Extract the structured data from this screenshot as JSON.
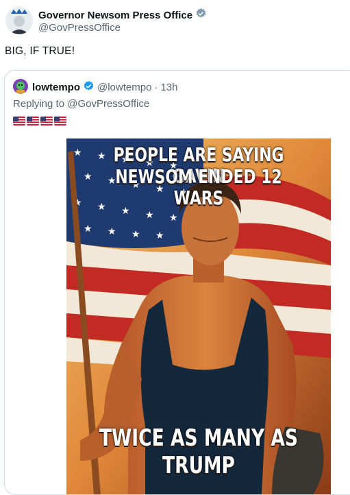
{
  "author": {
    "display_name": "Governor Newsom Press Office",
    "handle": "@GovPressOffice",
    "verified_badge": "gray-verified-badge-icon"
  },
  "tweet": {
    "text": "BIG, IF TRUE!"
  },
  "quoted_tweet": {
    "display_name": "lowtempo",
    "handle": "@lowtempo",
    "separator": "·",
    "time": "13h",
    "verified_badge": "blue-verified-badge-icon",
    "replying_prefix": "Replying to ",
    "replying_to": "@GovPressOffice",
    "flags": [
      "us-flag-icon",
      "us-flag-icon",
      "us-flag-icon",
      "us-flag-icon"
    ],
    "image": {
      "top_text_line1": "PEOPLE ARE SAYING GAVIN",
      "top_text_line2": "NEWSOM ENDED 12 WARS",
      "bottom_text_line1": "TWICE AS MANY AS",
      "bottom_text_line2": "TRUMP"
    }
  },
  "colors": {
    "text_primary": "#0f1419",
    "text_secondary": "#536471",
    "border": "#cfd9de",
    "verified_blue": "#1d9bf0",
    "verified_gray": "#829aab"
  }
}
